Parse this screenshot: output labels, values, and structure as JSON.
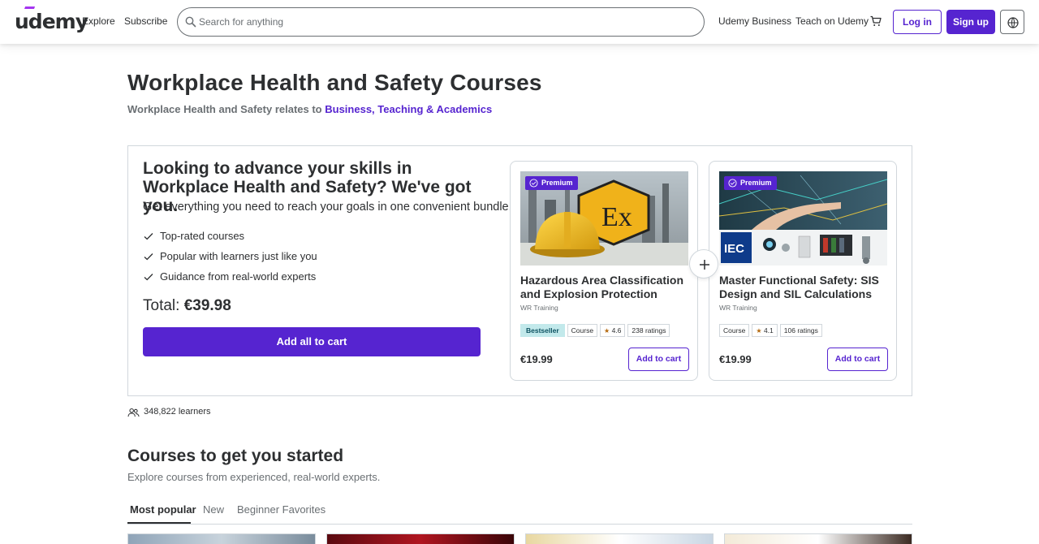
{
  "header": {
    "logo": "udemy",
    "explore": "Explore",
    "subscribe": "Subscribe",
    "search_placeholder": "Search for anything",
    "udemy_business": "Udemy Business",
    "teach": "Teach on Udemy",
    "login": "Log in",
    "signup": "Sign up"
  },
  "page": {
    "title": "Workplace Health and Safety Courses",
    "relates_prefix": "Workplace Health and Safety relates to",
    "relates_link1": "Business,",
    "relates_link2": "Teaching & Academics"
  },
  "bundle": {
    "heading": "Looking to advance your skills in Workplace Health and Safety? We've got you.",
    "subheading": "Get everything you need to reach your goals in one convenient bundle.",
    "benefits": [
      "Top-rated courses",
      "Popular with learners just like you",
      "Guidance from real-world experts"
    ],
    "total_label": "Total:",
    "total_amount": "€39.98",
    "add_all": "Add all to cart",
    "courses": [
      {
        "badge": "Premium",
        "title": "Hazardous Area Classification and Explosion Protection",
        "author": "WR Training",
        "bestseller": "Bestseller",
        "type": "Course",
        "rating": "4.6",
        "ratings_count": "238 ratings",
        "price": "€19.99",
        "add": "Add to cart"
      },
      {
        "badge": "Premium",
        "title": "Master Functional Safety: SIS Design and SIL Calculations",
        "author": "WR Training",
        "type": "Course",
        "rating": "4.1",
        "ratings_count": "106 ratings",
        "price": "€19.99",
        "add": "Add to cart"
      }
    ]
  },
  "learners": "348,822 learners",
  "section": {
    "title": "Courses to get you started",
    "subtitle": "Explore courses from experienced, real-world experts.",
    "tabs": [
      "Most popular",
      "New",
      "Beginner Favorites"
    ]
  },
  "colors": {
    "brand": "#5624d0",
    "text": "#2d2f31",
    "muted": "#6a6f73",
    "bestseller_bg": "#c2e9eb",
    "star": "#b4690e"
  }
}
